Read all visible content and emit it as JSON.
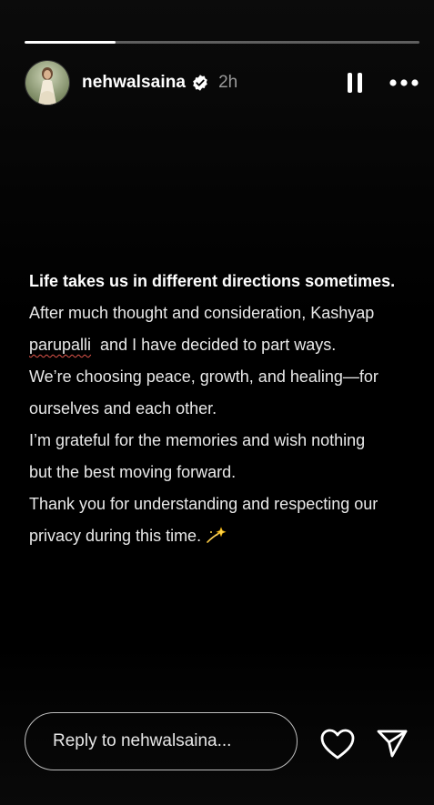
{
  "story": {
    "progress_fraction": 0.23,
    "username": "nehwalsaina",
    "verified": true,
    "time_ago": "2h",
    "lines": {
      "headline": "Life takes us in different directions sometimes.",
      "l1": "After much thought and consideration, Kashyap",
      "l2_name": "parupalli",
      "l2_rest": "  and I have decided to part ways.",
      "l3": "We’re choosing peace, growth, and healing—for",
      "l4": "ourselves and each other.",
      "l5": "I’m grateful for the memories and wish nothing",
      "l6": "but the best moving forward.",
      "l7": "Thank you for understanding and respecting our",
      "l8": "privacy during this time."
    }
  },
  "reply": {
    "placeholder": "Reply to nehwalsaina..."
  },
  "icons": {
    "pause": "pause-icon",
    "more": "more-icon",
    "heart": "heart-icon",
    "share": "paper-plane-icon",
    "sparkle": "dizzy-sparkle-emoji",
    "verified": "verified-badge-icon"
  },
  "colors": {
    "background": "#000000",
    "text": "#ffffff",
    "secondary_text": "#9a9a9a",
    "progress_track": "#595959"
  }
}
